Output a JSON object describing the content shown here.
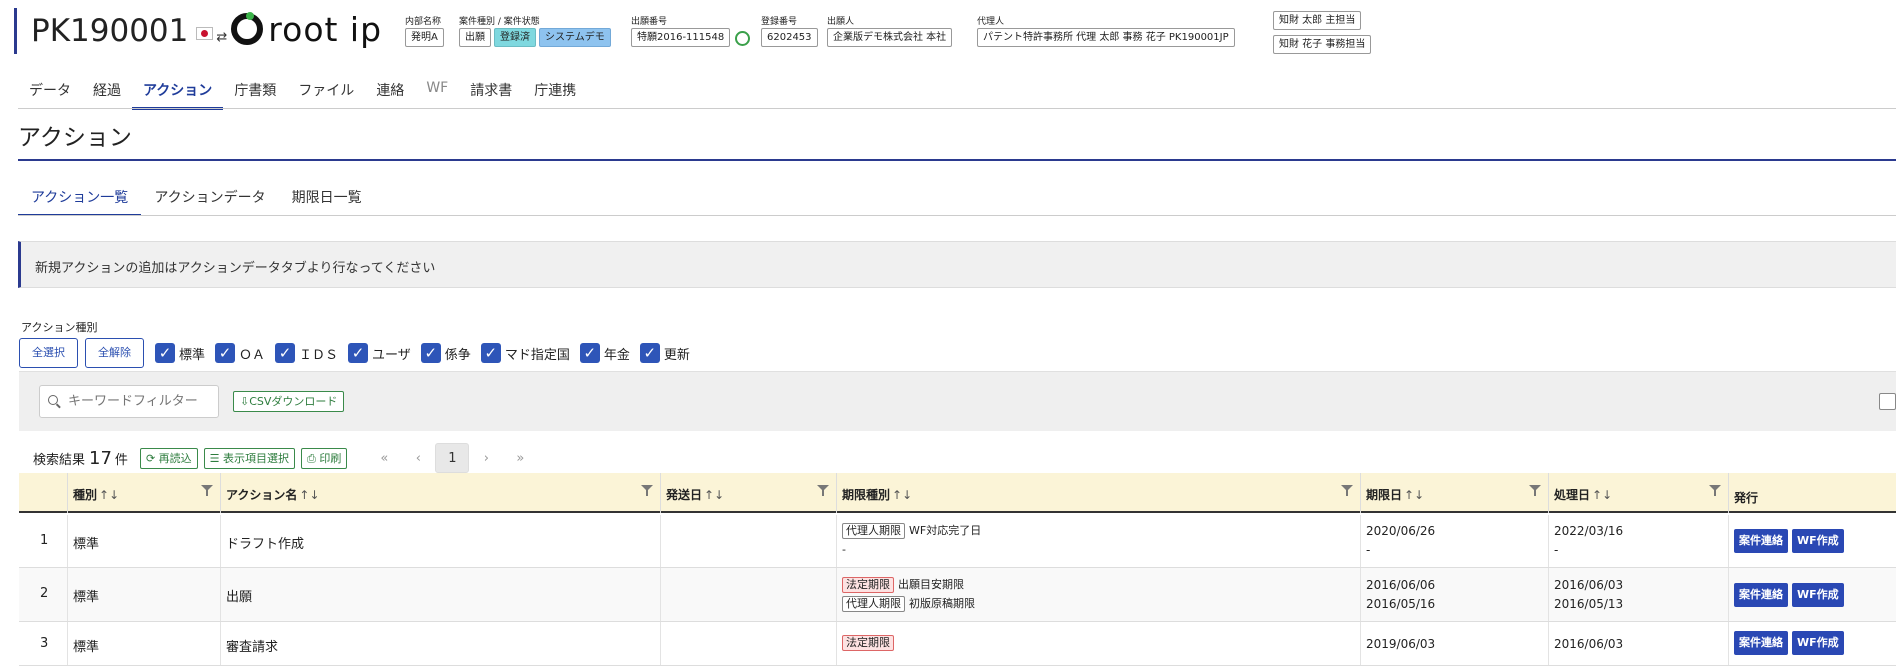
{
  "header": {
    "case_no": "PK190001",
    "logo_text": "root ip",
    "fields": [
      {
        "label": "内部名称",
        "values": [
          "発明A"
        ]
      },
      {
        "label": "案件種別 / 案件状態",
        "values": [
          "出願",
          "登録済",
          "システムデモ"
        ]
      },
      {
        "label": "出願番号",
        "values": [
          "特願2016-111548"
        ]
      },
      {
        "label": "登録番号",
        "values": [
          "6202453"
        ]
      },
      {
        "label": "出願人",
        "values": [
          "企業版デモ株式会社 本社"
        ]
      },
      {
        "label": "代理人",
        "values": [
          "パテント特許事務所 代理 太郎 事務 花子 PK190001JP"
        ]
      }
    ],
    "staff": [
      "知財 太郎 主担当",
      "知財 花子 事務担当"
    ]
  },
  "main_tabs": [
    "データ",
    "経過",
    "アクション",
    "庁書類",
    "ファイル",
    "連絡",
    "WF",
    "請求書",
    "庁連携"
  ],
  "page_title": "アクション",
  "sub_tabs": [
    "アクション一覧",
    "アクションデータ",
    "期限日一覧"
  ],
  "notice": "新規アクションの追加はアクションデータタブより行なってください",
  "action_types": {
    "label": "アクション種別",
    "select_all": "全選択",
    "deselect_all": "全解除",
    "options": [
      "標準",
      "ＯＡ",
      "ＩＤＳ",
      "ユーザ",
      "係争",
      "マド指定国",
      "年金",
      "更新"
    ]
  },
  "toolbar": {
    "keyword_placeholder": "キーワードフィルター",
    "csv_label": "CSVダウンロード"
  },
  "results": {
    "label": "検索結果",
    "count": "17",
    "unit": "件",
    "reload": "再読込",
    "columns_select": "表示項目選択",
    "print": "印刷",
    "pager": [
      "«",
      "‹",
      "1",
      "›",
      "»"
    ]
  },
  "table": {
    "headers": [
      "種別",
      "アクション名",
      "発送日",
      "期限種別",
      "期限日",
      "処理日",
      "発行"
    ],
    "rows": [
      {
        "no": "1",
        "type": "標準",
        "name": "ドラフト作成",
        "sent": "",
        "limits": [
          {
            "tag": "代理人期限",
            "red": false,
            "text": "WF対応完了日"
          },
          {
            "tag": "",
            "red": false,
            "text": "-"
          }
        ],
        "due": [
          "2020/06/26",
          "-"
        ],
        "done": [
          "2022/03/16",
          "-"
        ]
      },
      {
        "no": "2",
        "type": "標準",
        "name": "出願",
        "sent": "",
        "limits": [
          {
            "tag": "法定期限",
            "red": true,
            "text": "出願目安期限"
          },
          {
            "tag": "代理人期限",
            "red": false,
            "text": "初版原稿期限"
          }
        ],
        "due": [
          "2016/06/06",
          "2016/05/16"
        ],
        "done": [
          "2016/06/03",
          "2016/05/13"
        ]
      },
      {
        "no": "3",
        "type": "標準",
        "name": "審査請求",
        "sent": "",
        "limits": [
          {
            "tag": "法定期限",
            "red": true,
            "text": ""
          }
        ],
        "due": [
          "2019/06/03"
        ],
        "done": [
          "2016/06/03"
        ]
      }
    ],
    "btn_case": "案件連絡",
    "btn_wf": "WF作成"
  }
}
